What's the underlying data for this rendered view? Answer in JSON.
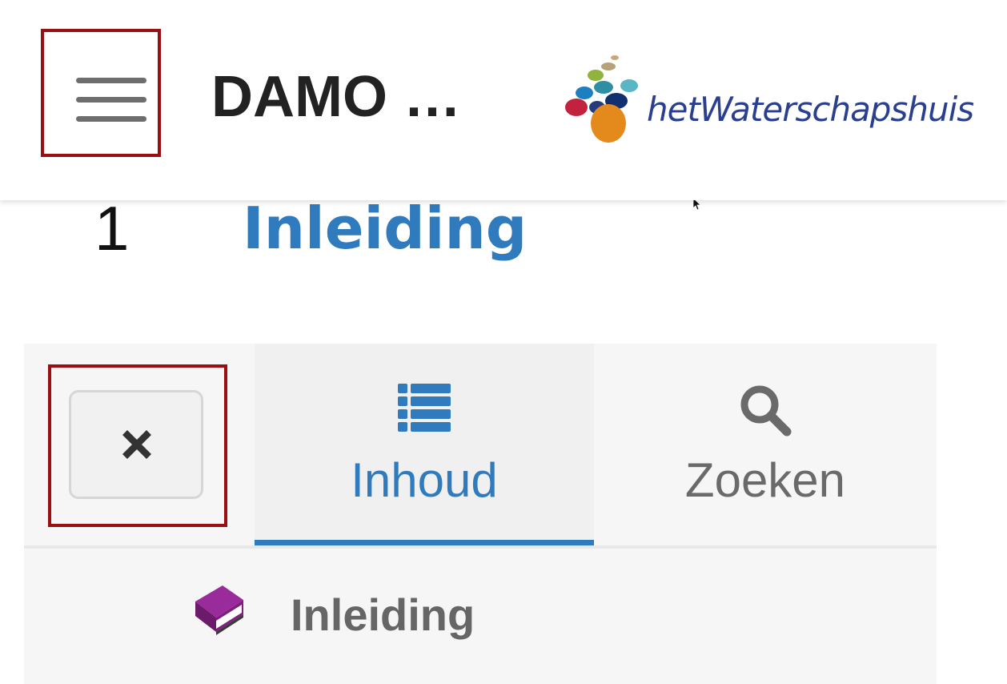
{
  "header": {
    "app_title": "DAMO …",
    "logo_text": "hetWaterschapshuis"
  },
  "heading": {
    "number": "1",
    "title": "Inleiding"
  },
  "panel": {
    "tabs": [
      {
        "label": "Inhoud",
        "icon": "list-icon",
        "active": true
      },
      {
        "label": "Zoeken",
        "icon": "search-icon",
        "active": false
      }
    ],
    "toc": [
      {
        "label": "Inleiding",
        "icon": "book-icon"
      }
    ]
  },
  "colors": {
    "accent": "#2f7bbd",
    "highlight": "#9b0e12"
  }
}
